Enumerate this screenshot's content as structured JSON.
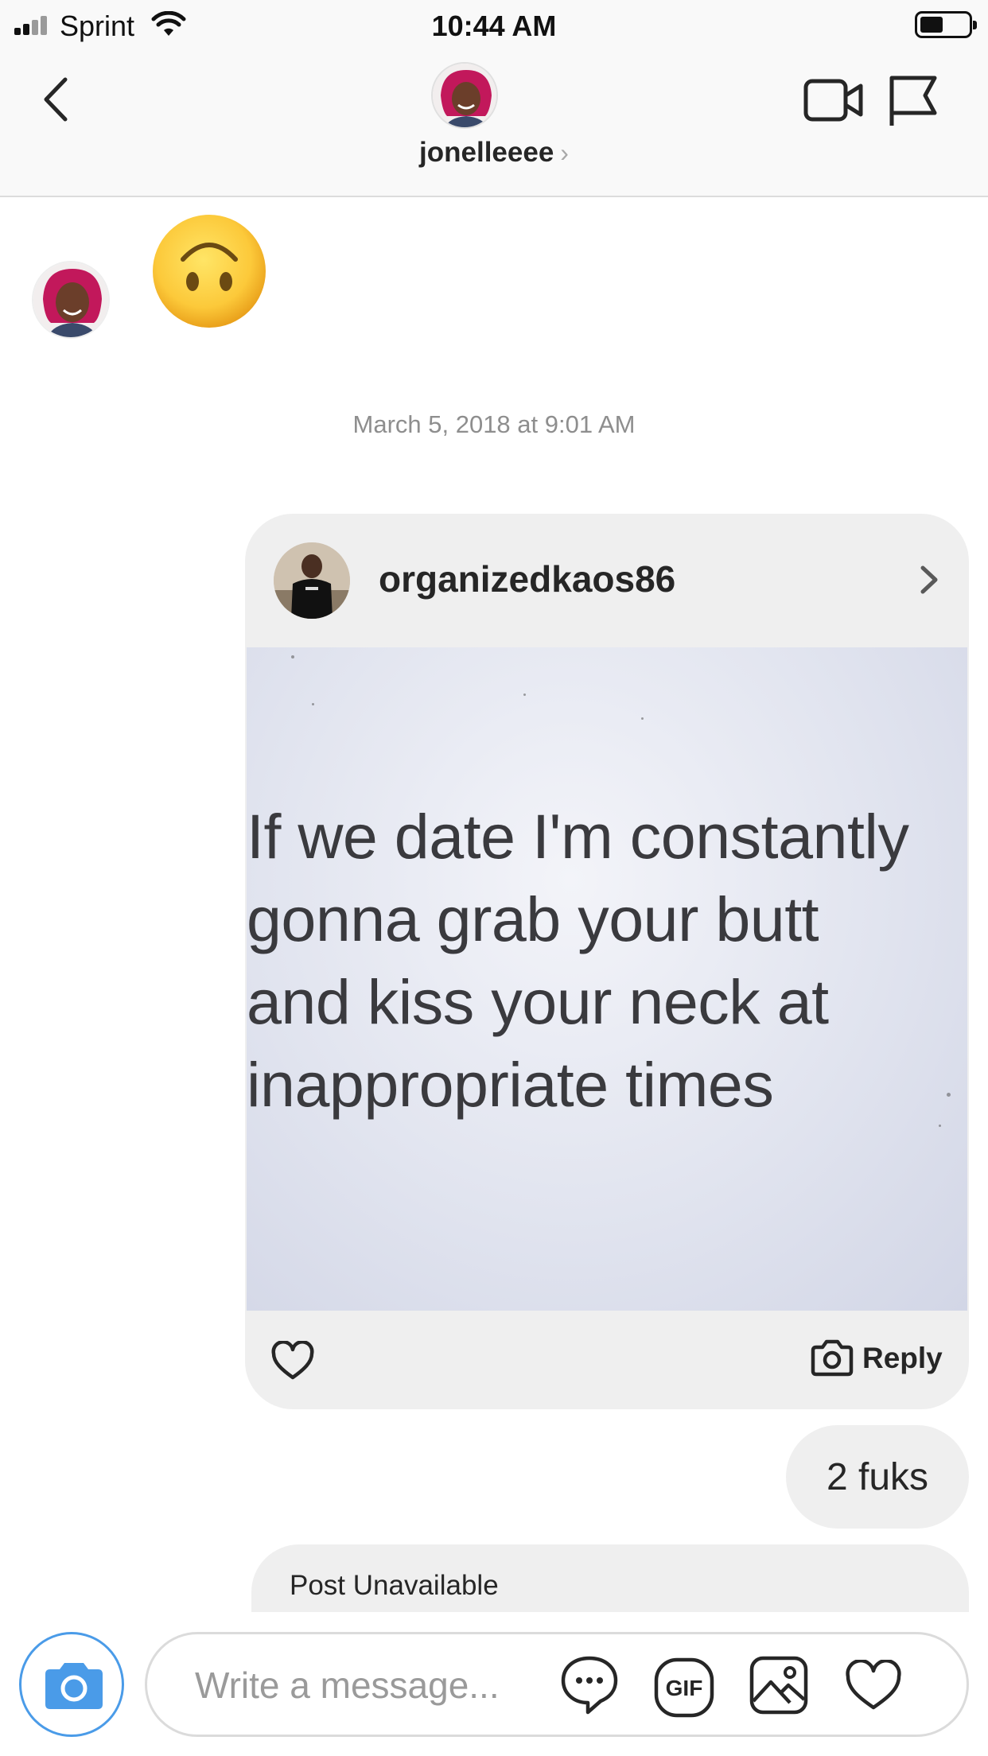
{
  "status_bar": {
    "carrier": "Sprint",
    "time": "10:44 AM",
    "battery_level": 0.45
  },
  "header": {
    "username": "jonelleeee",
    "chevron": "›"
  },
  "messages": {
    "emoji": "upside-down-face",
    "timestamp": "March 5, 2018 at 9:01 AM",
    "shared_post": {
      "username": "organizedkaos86",
      "image_text": [
        "If we date I'm constantly",
        "gonna grab your butt",
        "and kiss your neck at",
        "inappropriate times"
      ],
      "reply_label": "Reply"
    },
    "sent_text": "2 fuks",
    "unavailable_label": "Post Unavailable"
  },
  "composer": {
    "placeholder": "Write a message..."
  },
  "colors": {
    "accent_blue": "#4a9be8",
    "bubble_gray": "#efefef",
    "timestamp_gray": "#8e8e8e"
  }
}
